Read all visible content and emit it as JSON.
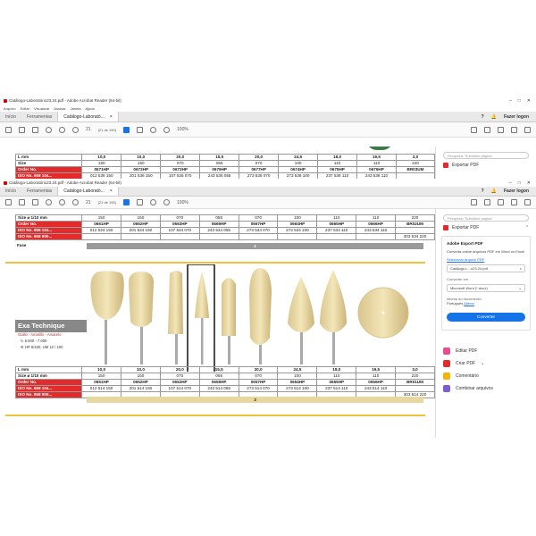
{
  "colors": {
    "order_red": "#e32b2b",
    "accent_blue": "#1473e6",
    "gold": "#f0c23a"
  },
  "back_window": {
    "title": "Catálogo-Laboratório23.24.pdf - Adobe Acrobat Reader (64-bit)",
    "menu": [
      "Arquivo",
      "Editar",
      "Visualizar",
      "Assinar",
      "Janela",
      "Ajuda"
    ],
    "tabs": [
      "Início",
      "Ferramentas",
      "Catálogo-Laborató..."
    ],
    "sign_in": "Fazer logon",
    "page_num": "21",
    "page_total": "(21 de 190)",
    "zoom": "100%",
    "search_placeholder": "Pesquisar 'Substituir página'",
    "export_label": "Exportar PDF",
    "table": {
      "rows": [
        {
          "label": "L mm",
          "cells": [
            "10,0",
            "10,0",
            "20,0",
            "15,5",
            "20,0",
            "24,5",
            "18,0",
            "19,5",
            "3,0"
          ]
        },
        {
          "label": "Size",
          "cells": [
            "150",
            "150",
            "070",
            "055",
            "070",
            "100",
            "110",
            "110",
            "220"
          ]
        },
        {
          "label": "Order No.",
          "cells": [
            "0671HP",
            "0672HP",
            "0673HP",
            "0679HP",
            "0677HP",
            "0674HP",
            "0675HP",
            "0676HP",
            "BR03UM"
          ]
        },
        {
          "label": "ISO No. 658 104...",
          "cells": [
            "012 536 150",
            "201 536 150",
            "107 536 070",
            "243 536 055",
            "273 536 070",
            "273 536 100",
            "237 536 110",
            "243 536 110",
            ""
          ]
        }
      ]
    }
  },
  "front_window": {
    "title": "Catálogo-Laboratório23.24.pdf - Adobe Acrobat Reader (64-bit)",
    "menu": [
      "Arquivo",
      "Editar",
      "Visualizar",
      "Assinar",
      "Janela",
      "Ajuda"
    ],
    "tabs": [
      "Início",
      "Ferramentas",
      "Catálogo-Laborató..."
    ],
    "sign_in": "Fazer logon",
    "page_num": "21",
    "page_total": "(21 de 190)",
    "zoom": "100%",
    "table_top": {
      "rows": [
        {
          "label": "Size  ⌀ 1/10 mm",
          "cells": [
            "150",
            "150",
            "070",
            "055",
            "070",
            "100",
            "110",
            "110",
            "220"
          ]
        },
        {
          "label": "Order No.",
          "cells": [
            "0661HP",
            "0662HP",
            "0663HP",
            "0669HP",
            "0667HP",
            "0664HP",
            "0665HP",
            "0666HP",
            "BR02UM"
          ]
        },
        {
          "label": "ISO No. 658 104...",
          "cells": [
            "012 534 150",
            "201 534 150",
            "107 534 070",
            "243 534 055",
            "273 534 070",
            "273 534 100",
            "237 534 110",
            "243 534 110",
            ""
          ]
        },
        {
          "label": "ISO No. 658 900...",
          "cells": [
            "",
            "",
            "",
            "",
            "",
            "",
            "",
            "",
            "303 534 220"
          ]
        }
      ],
      "fase_label": "Fase",
      "fase_value": "2"
    },
    "brand": {
      "name": "Exa Technique",
      "sub": "Giallo - Amarillo - Amarelo",
      "rpm": "5.000 - 7.000",
      "shank": "HP 6/100, UM 12 / 100"
    },
    "table_bottom": {
      "rows": [
        {
          "label": "L mm",
          "cells": [
            "10,0",
            "10,0",
            "20,0",
            "15,5",
            "20,0",
            "24,5",
            "18,0",
            "19,5",
            "3,0"
          ]
        },
        {
          "label": "Size  ⌀ 1/10 mm",
          "cells": [
            "150",
            "150",
            "070",
            "055",
            "070",
            "100",
            "110",
            "110",
            "220"
          ]
        },
        {
          "label": "Order No.",
          "cells": [
            "0651HP",
            "0652HP",
            "0653HP",
            "0659HP",
            "0657HP",
            "0654HP",
            "0655HP",
            "0656HP",
            "BR01UM"
          ]
        },
        {
          "label": "ISO No. 658 104...",
          "cells": [
            "012 514 150",
            "201 514 150",
            "107 514 070",
            "243 514 055",
            "273 514 070",
            "273 514 100",
            "237 514 110",
            "243 514 110",
            ""
          ]
        },
        {
          "label": "ISO No. 658 900...",
          "cells": [
            "",
            "",
            "",
            "",
            "",
            "",
            "",
            "",
            "303 514 220"
          ]
        }
      ],
      "fase_value": "3"
    },
    "pane": {
      "search_placeholder": "Pesquisar 'Substituir página'",
      "export_label": "Exportar PDF",
      "card_title": "Adobe Export PDF",
      "card_desc": "Converta online arquivos PDF em Word ou Excel",
      "select_link": "Selecionar arquivo PDF",
      "file_name": "Catálogo-L...o23.24.pdf",
      "convert_to_label": "Converter em",
      "convert_to_value": "Microsoft Word (*.docx)",
      "lang_label": "Idioma do documento:",
      "lang_value": "Português",
      "lang_change": "Alterar",
      "convert_button": "Converter",
      "tools": [
        "Editar PDF",
        "Criar PDF",
        "Comentário",
        "Combinar arquivos"
      ]
    }
  }
}
